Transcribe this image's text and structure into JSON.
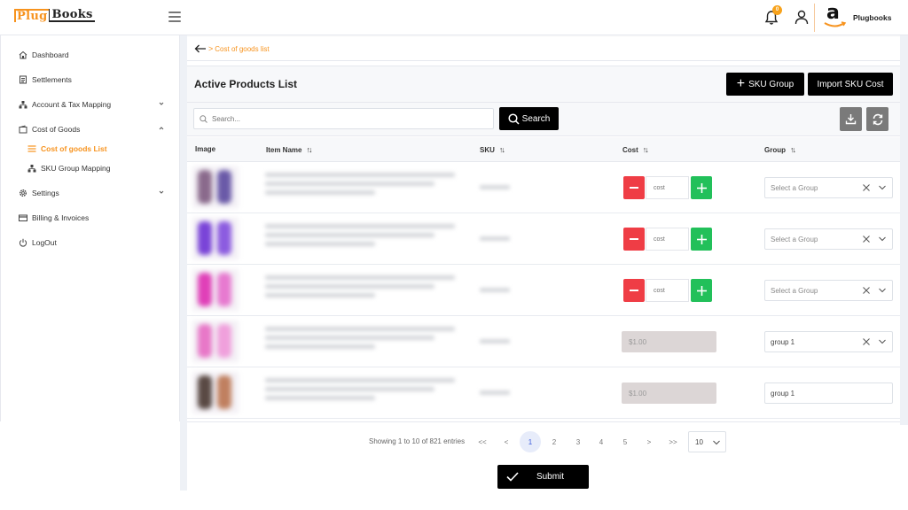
{
  "header": {
    "logo_part1": "Plug",
    "logo_part2": "Books",
    "notification_count": "0",
    "account_name": "Plugbooks",
    "marketplace_logo": "a"
  },
  "sidebar": {
    "items": [
      {
        "label": "Dashboard",
        "icon": "home-icon"
      },
      {
        "label": "Settlements",
        "icon": "receipt-icon"
      },
      {
        "label": "Account & Tax Mapping",
        "icon": "sitemap-icon",
        "expandable": true,
        "expanded": false
      },
      {
        "label": "Cost of Goods",
        "icon": "wallet-icon",
        "expandable": true,
        "expanded": true,
        "children": [
          {
            "label": "Cost of goods List",
            "icon": "list-icon",
            "active": true
          },
          {
            "label": "SKU Group Mapping",
            "icon": "sitemap-icon"
          }
        ]
      },
      {
        "label": "Settings",
        "icon": "gear-icon",
        "expandable": true,
        "expanded": false
      },
      {
        "label": "Billing & Invoices",
        "icon": "card-icon"
      },
      {
        "label": "LogOut",
        "icon": "power-icon"
      }
    ]
  },
  "breadcrumb": {
    "separator": ">",
    "current": "Cost of goods list"
  },
  "card": {
    "title": "Active Products List",
    "sku_group_button": "SKU Group",
    "import_button": "Import SKU Cost",
    "search_placeholder": "Search...",
    "search_button": "Search"
  },
  "table": {
    "columns": [
      {
        "label": "Image",
        "sortable": false
      },
      {
        "label": "Item Name",
        "sortable": true
      },
      {
        "label": "SKU",
        "sortable": true
      },
      {
        "label": "Cost",
        "sortable": true
      },
      {
        "label": "Group",
        "sortable": true
      }
    ],
    "sort_glyph": "↑↓",
    "cost_placeholder": "cost",
    "group_placeholder": "Select a Group",
    "rows": [
      {
        "item_name": "[blurred]",
        "sku": "[blurred]",
        "cost_mode": "editable",
        "cost": "",
        "group": "",
        "thumb_colors": [
          "#8a6a8c",
          "#6a5aa8"
        ]
      },
      {
        "item_name": "[blurred]",
        "sku": "[blurred]",
        "cost_mode": "editable",
        "cost": "",
        "group": "",
        "thumb_colors": [
          "#7a44d8",
          "#8c5ce0"
        ]
      },
      {
        "item_name": "[blurred]",
        "sku": "[blurred]",
        "cost_mode": "editable",
        "cost": "",
        "group": "",
        "thumb_colors": [
          "#e040b8",
          "#e77ad0"
        ]
      },
      {
        "item_name": "[blurred]",
        "sku": "[blurred]",
        "cost_mode": "fixed",
        "cost": "$1.00",
        "group": "group 1",
        "thumb_colors": [
          "#e878c8",
          "#f0a0dc"
        ]
      },
      {
        "item_name": "[blurred]",
        "sku": "[blurred]",
        "cost_mode": "fixed",
        "cost": "$1.00",
        "group": "group 1",
        "thumb_colors": [
          "#5a4a44",
          "#c08060"
        ]
      }
    ]
  },
  "pagination": {
    "summary": "Showing 1 to 10 of 821 entries",
    "first": "<<",
    "prev": "<",
    "pages": [
      "1",
      "2",
      "3",
      "4",
      "5"
    ],
    "current_page": "1",
    "next": ">",
    "last": ">>",
    "per_page": "10"
  },
  "submit_button": "Submit",
  "colors": {
    "brand_orange": "#f7931e",
    "danger_red": "#ef3d45",
    "success_green": "#22c05a",
    "dark_button": "#000000"
  }
}
